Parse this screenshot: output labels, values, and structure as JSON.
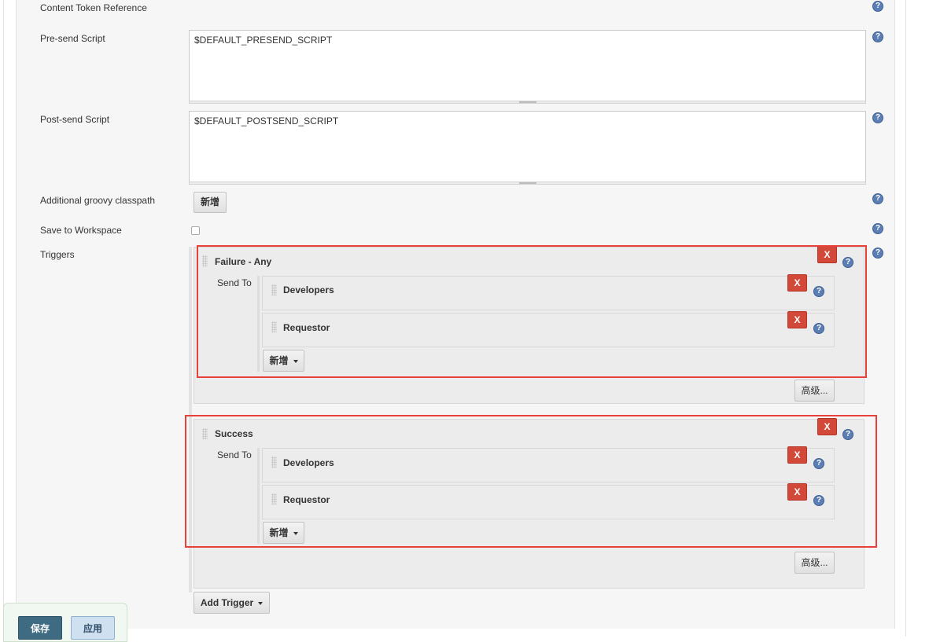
{
  "rows": {
    "content_token_label": "Content Token Reference",
    "presend_label": "Pre-send Script",
    "presend_value": "$DEFAULT_PRESEND_SCRIPT",
    "postsend_label": "Post-send Script",
    "postsend_value": "$DEFAULT_POSTSEND_SCRIPT",
    "classpath_label": "Additional groovy classpath",
    "classpath_add": "新增",
    "workspace_label": "Save to Workspace",
    "triggers_label": "Triggers"
  },
  "triggers": [
    {
      "name": "Failure - Any",
      "send_to_label": "Send To",
      "recipients": [
        "Developers",
        "Requestor"
      ],
      "add_label": "新增",
      "advanced_label": "高级..."
    },
    {
      "name": "Success",
      "send_to_label": "Send To",
      "recipients": [
        "Developers",
        "Requestor"
      ],
      "add_label": "新增",
      "advanced_label": "高级..."
    }
  ],
  "add_trigger_label": "Add Trigger",
  "delete_label": "X",
  "help_glyph": "?",
  "footer": {
    "save_label": "保存",
    "apply_label": "应用"
  },
  "colors": {
    "delete": "#d24939",
    "highlight": "#e8403a",
    "save": "#3e6a82"
  }
}
